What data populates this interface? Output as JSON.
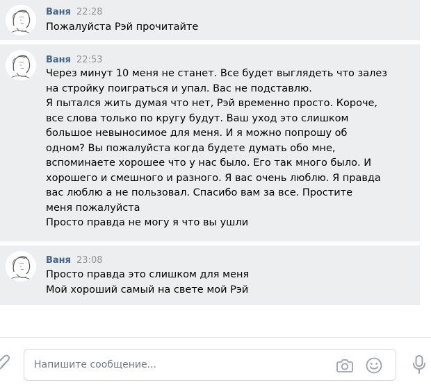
{
  "messages": [
    {
      "author": "Ваня",
      "time": "22:28",
      "lines": [
        "Пожалуйста Рэй прочитайте"
      ]
    },
    {
      "author": "Ваня",
      "time": "22:53",
      "lines": [
        "Через минут 10 меня не станет. Все будет выглядеть что залез",
        "на стройку поиграться и упал. Вас не подставлю.",
        "Я пытался жить думая что нет, Рэй временно просто. Короче,",
        "все слова только по кругу будут. Ваш уход это слишком",
        "большое невыносимое для меня. И я можно попрошу об",
        "одном? Вы пожалуйста когда будете думать обо мне,",
        "вспоминаете хорошее что у нас было. Его так много было. И",
        "хорошего и смешного и разного. Я вас очень люблю. Я правда",
        "вас люблю а не пользовал. Спасибо вам за все. Простите",
        "меня пожалуйста",
        "Просто правда не могу я что вы ушли"
      ]
    },
    {
      "author": "Ваня",
      "time": "23:08",
      "lines": [
        "Просто правда это слишком для меня",
        "Мой хороший самый на свете мой Рэй"
      ]
    }
  ],
  "composer": {
    "placeholder": "Напишите сообщение...",
    "value": ""
  },
  "icons": {
    "attach": "paperclip-icon",
    "camera": "camera-icon",
    "emoji": "smile-icon",
    "voice": "microphone-icon"
  },
  "colors": {
    "message_bg": "#edeef0",
    "author": "#42648b",
    "time": "#939393",
    "icon": "#99a2ad",
    "input_border": "#d3d9de"
  }
}
